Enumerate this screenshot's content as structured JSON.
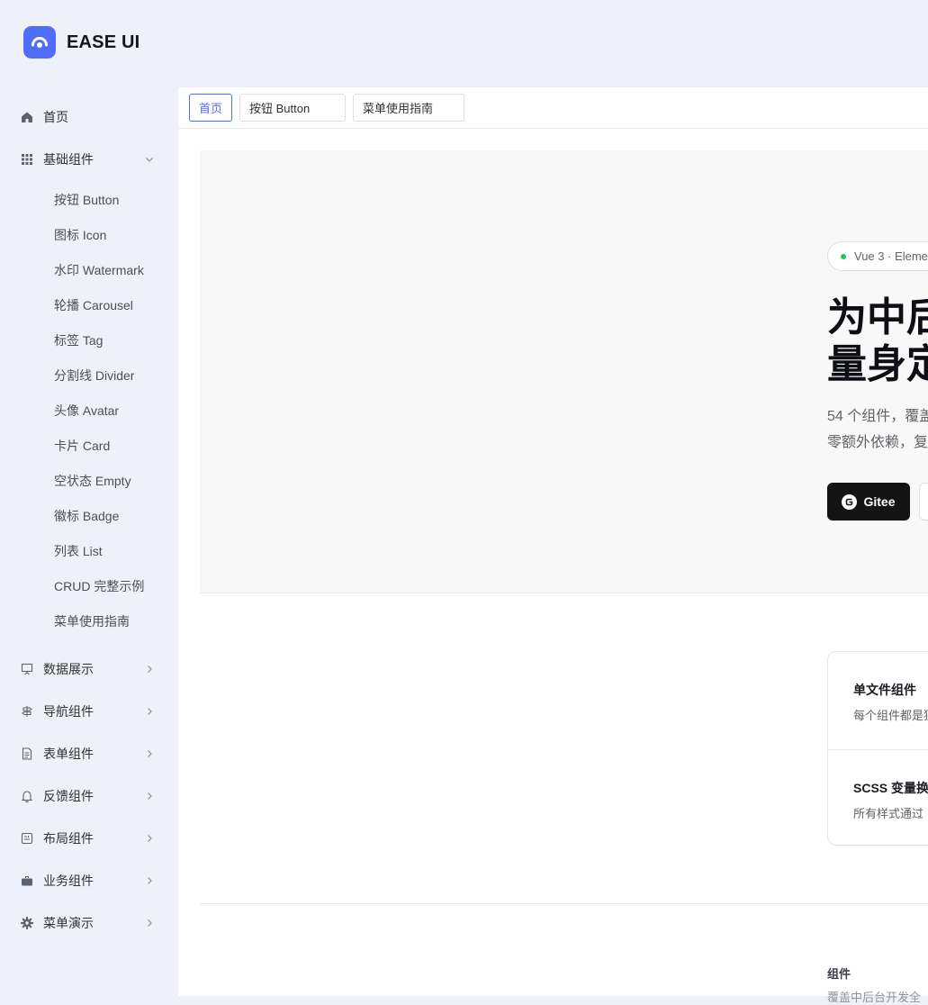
{
  "brand": {
    "name": "EASE UI",
    "color": "#4f6ef7"
  },
  "sidebar": {
    "home": {
      "label": "首页",
      "icon": "home-icon"
    },
    "basic": {
      "label": "基础组件",
      "icon": "grid-icon",
      "expanded": true,
      "children": [
        "按钮 Button",
        "图标 Icon",
        "水印 Watermark",
        "轮播 Carousel",
        "标签 Tag",
        "分割线 Divider",
        "头像 Avatar",
        "卡片 Card",
        "空状态 Empty",
        "徽标 Badge",
        "列表 List",
        "CRUD 完整示例",
        "菜单使用指南"
      ]
    },
    "groups": [
      {
        "label": "数据展示",
        "icon": "presentation-icon"
      },
      {
        "label": "导航组件",
        "icon": "signpost-icon"
      },
      {
        "label": "表单组件",
        "icon": "document-icon"
      },
      {
        "label": "反馈组件",
        "icon": "bell-icon"
      },
      {
        "label": "布局组件",
        "icon": "layout-icon"
      },
      {
        "label": "业务组件",
        "icon": "briefcase-icon"
      },
      {
        "label": "菜单演示",
        "icon": "gear-icon"
      }
    ]
  },
  "tabs": [
    {
      "label": "首页",
      "active": true
    },
    {
      "label": "按钮 Button",
      "active": false
    },
    {
      "label": "菜单使用指南",
      "active": false
    }
  ],
  "hero": {
    "badge": "Vue 3 · Eleme",
    "title_line1": "为中后",
    "title_line2": "量身定",
    "desc_line1": "54 个组件，覆盖",
    "desc_line2": "零额外依赖，复",
    "primary_button": "Gitee"
  },
  "features": [
    {
      "title": "单文件组件",
      "desc": "每个组件都是独"
    },
    {
      "title": "SCSS 变量换肤",
      "desc": "所有样式通过 "
    }
  ],
  "section": {
    "label": "组件",
    "sub": "覆盖中后台开发全"
  }
}
